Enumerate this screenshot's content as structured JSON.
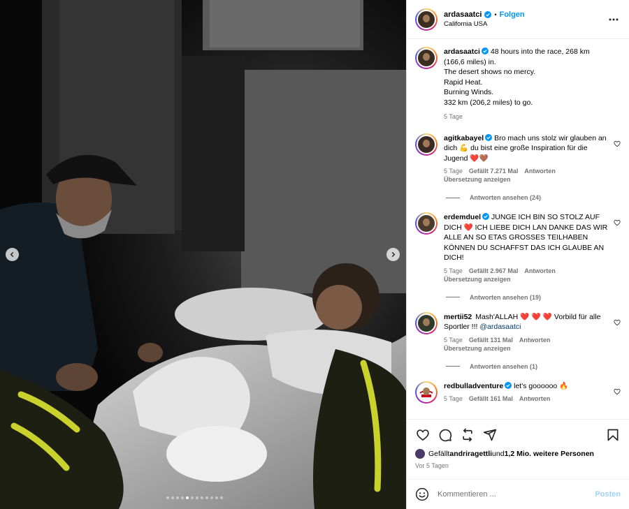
{
  "post": {
    "username": "ardasaatci",
    "follow_label": "Folgen",
    "separator": "•",
    "location": "California USA",
    "verified_icon": "verified-badge-icon",
    "more_icon": "more-options-icon"
  },
  "media": {
    "carousel_total": 12,
    "carousel_active_index": 4,
    "prev_icon": "chevron-left-icon",
    "next_icon": "chevron-right-icon"
  },
  "caption": {
    "username": "ardasaatci",
    "lines": [
      "48 hours into the race, 268 km (166,6 miles) in.",
      "The desert shows no mercy.",
      "Rapid Heat.",
      "Burning Winds.",
      "332 km (206,2 miles) to go."
    ],
    "time": "5 Tage"
  },
  "comments": [
    {
      "username": "agitkabayel",
      "text_a": "Bro mach uns stolz wir glauben an dich ",
      "emoji_a": "💪",
      "text_b": " du bist eine große Inspiration für die Jugend ",
      "emoji_b": "❤️🤎",
      "time": "5 Tage",
      "likes": "Gefällt 7.271 Mal",
      "reply": "Antworten",
      "translate": "Übersetzung anzeigen",
      "replies": "Antworten ansehen (24)"
    },
    {
      "username": "erdemduel",
      "text_a": "JUNGE ICH BIN SO STOLZ AUF DICH ",
      "emoji_a": "❤️",
      "text_b": " ICH LIEBE DICH LAN DANKE DAS WIR ALLE AN SO ETAS GROSSES TEILHABEN KÖNNEN DU SCHAFFST DAS ICH GLAUBE AN DICH!",
      "time": "5 Tage",
      "likes": "Gefällt 2.967 Mal",
      "reply": "Antworten",
      "translate": "Übersetzung anzeigen",
      "replies": "Antworten ansehen (19)"
    },
    {
      "username": "mertii52",
      "text_a": "Mash'ALLAH ",
      "emoji_a": "❤️ ❤️ ❤️",
      "text_b": " Vorbild für alle Sportler !!! ",
      "mention": "@ardasaatci",
      "time": "5 Tage",
      "likes": "Gefällt 131 Mal",
      "reply": "Antworten",
      "translate": "Übersetzung anzeigen",
      "replies": "Antworten ansehen (1)"
    },
    {
      "username": "redbulladventure",
      "text_a": "let's goooooo ",
      "emoji_a": "🔥",
      "time": "5 Tage",
      "likes": "Gefällt 161 Mal",
      "reply": "Antworten"
    }
  ],
  "actions": {
    "like_icon": "heart-icon",
    "comment_icon": "comment-icon",
    "repost_icon": "repost-icon",
    "share_icon": "share-icon",
    "save_icon": "bookmark-icon",
    "likes_prefix": "Gefällt ",
    "likes_user": "andriragettli",
    "likes_mid": " und ",
    "likes_rest": "1,2 Mio. weitere Personen",
    "posted_ago": "Vor 5 Tagen"
  },
  "composer": {
    "placeholder": "Kommentieren ...",
    "post_label": "Posten",
    "emoji_icon": "emoji-smiley-icon"
  },
  "colors": {
    "accent": "#0095f6",
    "muted": "#737373",
    "heart": "#e0245e",
    "post_disabled": "#9fd2fb"
  }
}
